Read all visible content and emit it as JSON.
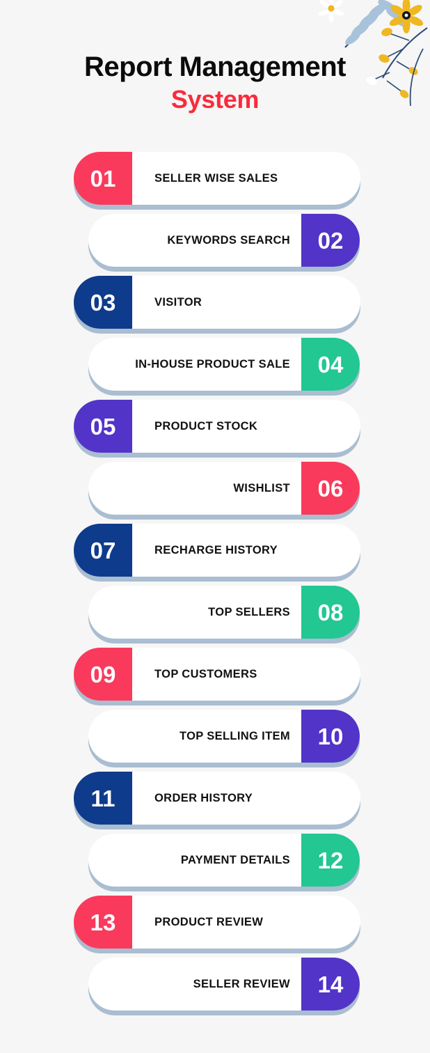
{
  "page": {
    "background_color": "#f5f6f5"
  },
  "header": {
    "title_line1": "Report Management",
    "title_line2": "System",
    "accent_color": "#fb2a3c"
  },
  "palette": {
    "red": "#f93a5c",
    "purple": "#5234c9",
    "navy": "#0e3b8c",
    "green": "#22c792",
    "shadow": "#aabdd1",
    "pill": "#ffffff",
    "text": "#111111"
  },
  "decoration": {
    "name": "floral-corner-illustration",
    "leaf_color": "#a8c2da",
    "flower_color": "#efb721",
    "stem_color": "#2f4d7a",
    "daisy_color": "#ffffff",
    "daisy_center_color": "#efb721"
  },
  "items": [
    {
      "number": "01",
      "label": "SELLER WISE SALES",
      "side": "left",
      "color": "#f93a5c"
    },
    {
      "number": "02",
      "label": "KEYWORDS SEARCH",
      "side": "right",
      "color": "#5234c9"
    },
    {
      "number": "03",
      "label": "VISITOR",
      "side": "left",
      "color": "#0e3b8c"
    },
    {
      "number": "04",
      "label": "IN-HOUSE PRODUCT SALE",
      "side": "right",
      "color": "#22c792"
    },
    {
      "number": "05",
      "label": "PRODUCT STOCK",
      "side": "left",
      "color": "#5234c9"
    },
    {
      "number": "06",
      "label": "WISHLIST",
      "side": "right",
      "color": "#f93a5c"
    },
    {
      "number": "07",
      "label": "RECHARGE HISTORY",
      "side": "left",
      "color": "#0e3b8c"
    },
    {
      "number": "08",
      "label": "TOP SELLERS",
      "side": "right",
      "color": "#22c792"
    },
    {
      "number": "09",
      "label": "TOP CUSTOMERS",
      "side": "left",
      "color": "#f93a5c"
    },
    {
      "number": "10",
      "label": "TOP SELLING ITEM",
      "side": "right",
      "color": "#5234c9"
    },
    {
      "number": "11",
      "label": "ORDER HISTORY",
      "side": "left",
      "color": "#0e3b8c"
    },
    {
      "number": "12",
      "label": "PAYMENT DETAILS",
      "side": "right",
      "color": "#22c792"
    },
    {
      "number": "13",
      "label": "PRODUCT REVIEW",
      "side": "left",
      "color": "#f93a5c"
    },
    {
      "number": "14",
      "label": "SELLER REVIEW",
      "side": "right",
      "color": "#5234c9"
    }
  ]
}
